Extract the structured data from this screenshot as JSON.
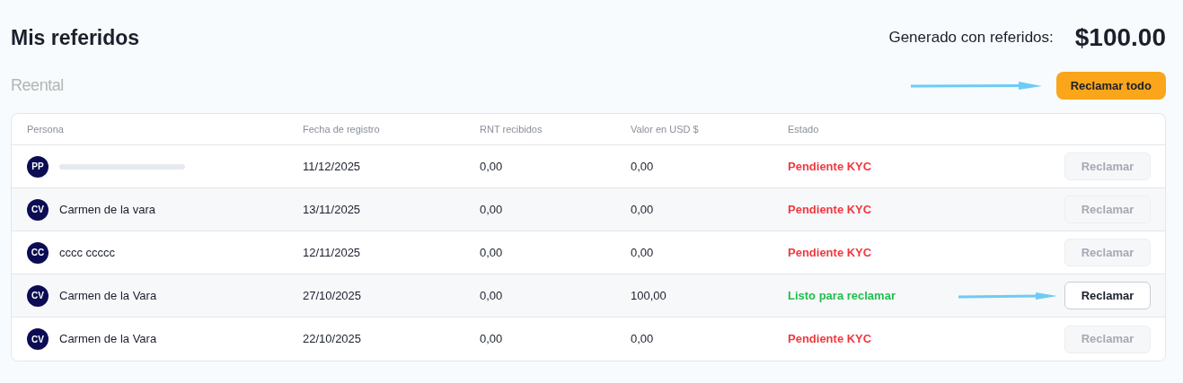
{
  "page_title": "Mis referidos",
  "earnings": {
    "label": "Generado con referidos:",
    "amount": "$100.00"
  },
  "logo": "Reental",
  "claim_all_button": {
    "label": "Reclamar todo",
    "highlighted": true
  },
  "table": {
    "columns": [
      "Persona",
      "Fecha de registro",
      "RNT recibidos",
      "Valor en USD $",
      "Estado"
    ],
    "rows": [
      {
        "initials": "PP",
        "name_redacted": true,
        "date": "11/12/2025",
        "rnt": "0,00",
        "usd": "0,00",
        "status": {
          "kind": "pending",
          "text": "Pendiente KYC"
        },
        "button": {
          "label": "Reclamar",
          "disabled": true,
          "highlighted": false
        }
      },
      {
        "initials": "CV",
        "name": "Carmen de la vara",
        "date": "13/11/2025",
        "rnt": "0,00",
        "usd": "0,00",
        "status": {
          "kind": "pending",
          "text": "Pendiente KYC"
        },
        "button": {
          "label": "Reclamar",
          "disabled": true,
          "highlighted": false
        }
      },
      {
        "initials": "CC",
        "name": "cccc ccccc",
        "date": "12/11/2025",
        "rnt": "0,00",
        "usd": "0,00",
        "status": {
          "kind": "pending",
          "text": "Pendiente KYC"
        },
        "button": {
          "label": "Reclamar",
          "disabled": true,
          "highlighted": false
        }
      },
      {
        "initials": "CV",
        "name": "Carmen de la Vara",
        "date": "27/10/2025",
        "rnt": "0,00",
        "usd": "100,00",
        "status": {
          "kind": "ready",
          "text": "Listo para reclamar"
        },
        "button": {
          "label": "Reclamar",
          "disabled": false,
          "highlighted": true
        }
      },
      {
        "initials": "CV",
        "name": "Carmen de la Vara",
        "date": "22/10/2025",
        "rnt": "0,00",
        "usd": "0,00",
        "status": {
          "kind": "pending",
          "text": "Pendiente KYC"
        },
        "button": {
          "label": "Reclamar",
          "disabled": true,
          "highlighted": false
        }
      }
    ]
  }
}
